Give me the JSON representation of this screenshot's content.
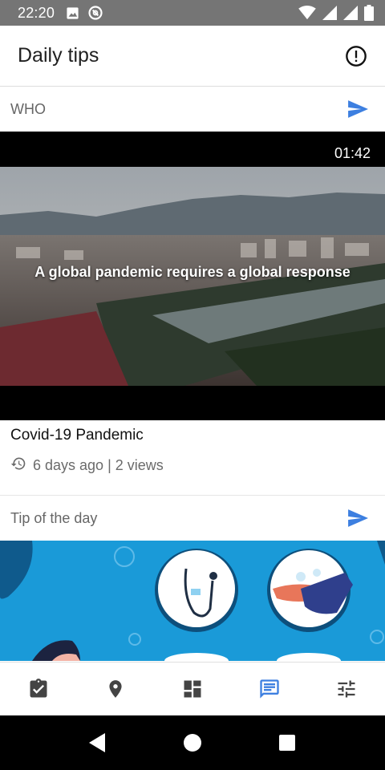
{
  "status_bar": {
    "time": "22:20",
    "left_icons": [
      "image-icon",
      "at-sign-icon"
    ],
    "right_icons": [
      "wifi-icon",
      "signal-icon",
      "signal-icon",
      "battery-icon"
    ]
  },
  "app_bar": {
    "title": "Daily tips",
    "info_icon": "alert-circle-icon"
  },
  "sections": [
    {
      "title": "WHO",
      "action_icon": "send-icon",
      "video": {
        "duration": "01:42",
        "caption": "A global pandemic requires a global response",
        "title": "Covid-19 Pandemic",
        "stats": "6 days ago | 2 views",
        "stats_icon": "history-icon"
      }
    },
    {
      "title": "Tip of the day",
      "action_icon": "send-icon"
    }
  ],
  "bottom_nav": {
    "items": [
      "assignment-check-icon",
      "location-pin-icon",
      "dashboard-icon",
      "chat-icon",
      "tune-icon"
    ],
    "active_index": 3
  },
  "system_nav": [
    "back-icon",
    "home-icon",
    "recents-icon"
  ],
  "colors": {
    "accent": "#3d7fe0",
    "status_bar": "#757575",
    "tip_background": "#1a9ad8"
  }
}
